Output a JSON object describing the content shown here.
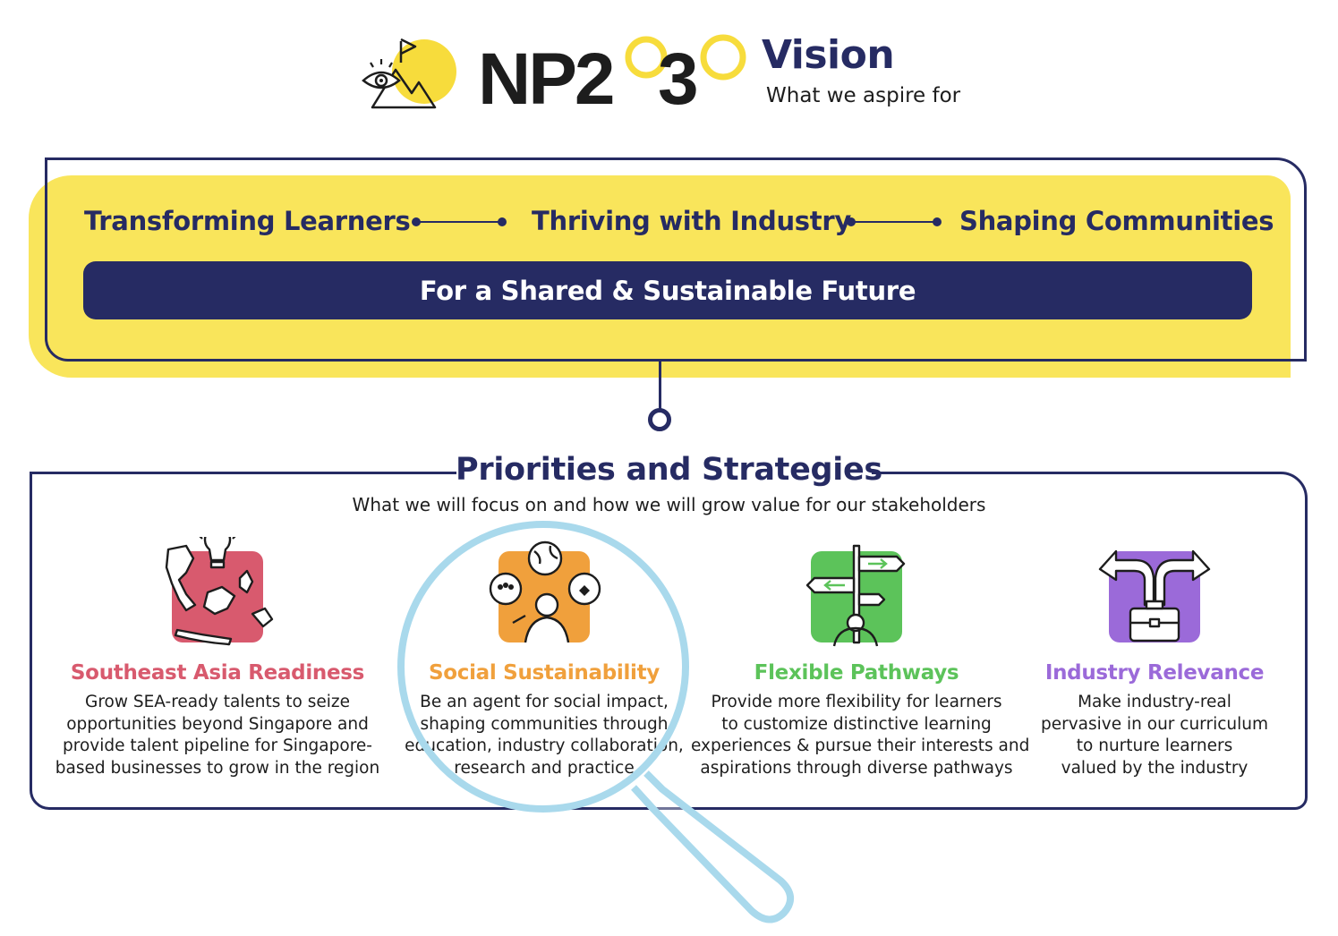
{
  "header": {
    "logo_text": "NP2030",
    "title": "Vision",
    "subtitle": "What we aspire for"
  },
  "vision": {
    "pillars": [
      "Transforming Learners",
      "Thriving with Industry",
      "Shaping Communities"
    ],
    "tagline": "For a Shared & Sustainable Future"
  },
  "priorities": {
    "title": "Priorities and Strategies",
    "subtitle": "What we will focus on and how we will grow value for our stakeholders",
    "items": [
      {
        "label": "Southeast Asia Readiness",
        "color": "#d85a6e",
        "icon": "southeast-asia-map-lightbulb-icon",
        "desc": [
          "Grow SEA-ready talents to seize",
          "opportunities beyond Singapore and",
          "provide talent pipeline for Singapore-",
          "based businesses to grow in the region"
        ]
      },
      {
        "label": "Social Sustainability",
        "color": "#f0a03c",
        "icon": "community-globe-person-icon",
        "desc": [
          "Be an agent for social impact,",
          "shaping communities through",
          "education, industry collaboration,",
          "research and practice"
        ]
      },
      {
        "label": "Flexible Pathways",
        "color": "#5cc35a",
        "icon": "signpost-directions-icon",
        "desc": [
          "Provide more flexibility for learners",
          "to customize distinctive learning",
          "experiences & pursue their interests and",
          "aspirations through diverse pathways"
        ]
      },
      {
        "label": "Industry Relevance",
        "color": "#9b6ad9",
        "icon": "briefcase-split-arrows-icon",
        "desc": [
          "Make industry-real",
          "pervasive in our curriculum",
          "to nurture learners",
          "valued by the industry"
        ]
      }
    ]
  },
  "colors": {
    "navy": "#262b63",
    "yellow": "#f9e55b",
    "magnifier": "#a9d9ec"
  }
}
